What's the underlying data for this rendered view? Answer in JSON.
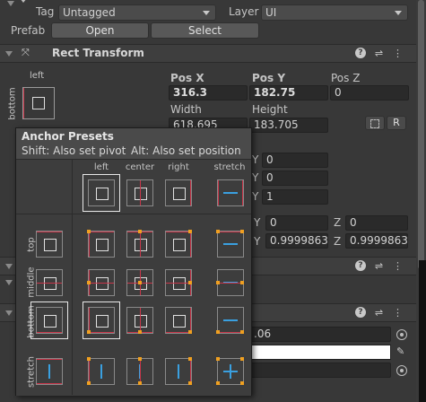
{
  "object": {
    "tag_label": "Tag",
    "tag_value": "Untagged",
    "layer_label": "Layer",
    "layer_value": "UI",
    "prefab_label": "Prefab",
    "open_label": "Open",
    "select_label": "Select"
  },
  "rect_transform": {
    "title": "Rect Transform",
    "anchor_h": "left",
    "anchor_v": "bottom",
    "pos_x_label": "Pos X",
    "pos_x": "316.3",
    "pos_y_label": "Pos Y",
    "pos_y": "182.75",
    "pos_z_label": "Pos Z",
    "pos_z": "0",
    "width_label": "Width",
    "width": "618.695",
    "height_label": "Height",
    "height": "183.705",
    "raw_btn": "R"
  },
  "behind_fields": {
    "y1": "0",
    "y2": "0",
    "y3": "1",
    "y4": "0",
    "z4": "0",
    "y5": "0.9999863",
    "z5": "0.9999863",
    "partial": ".06"
  },
  "presets": {
    "title": "Anchor Presets",
    "shift_hint": "Shift: Also set pivot",
    "alt_hint": "Alt: Also set position",
    "columns": [
      "left",
      "center",
      "right",
      "stretch"
    ],
    "rows": [
      "top",
      "middle",
      "bottom",
      "stretch"
    ]
  },
  "icons": {
    "help": "help-icon",
    "settings": "sliders-icon",
    "menu": "kebab-menu-icon"
  }
}
